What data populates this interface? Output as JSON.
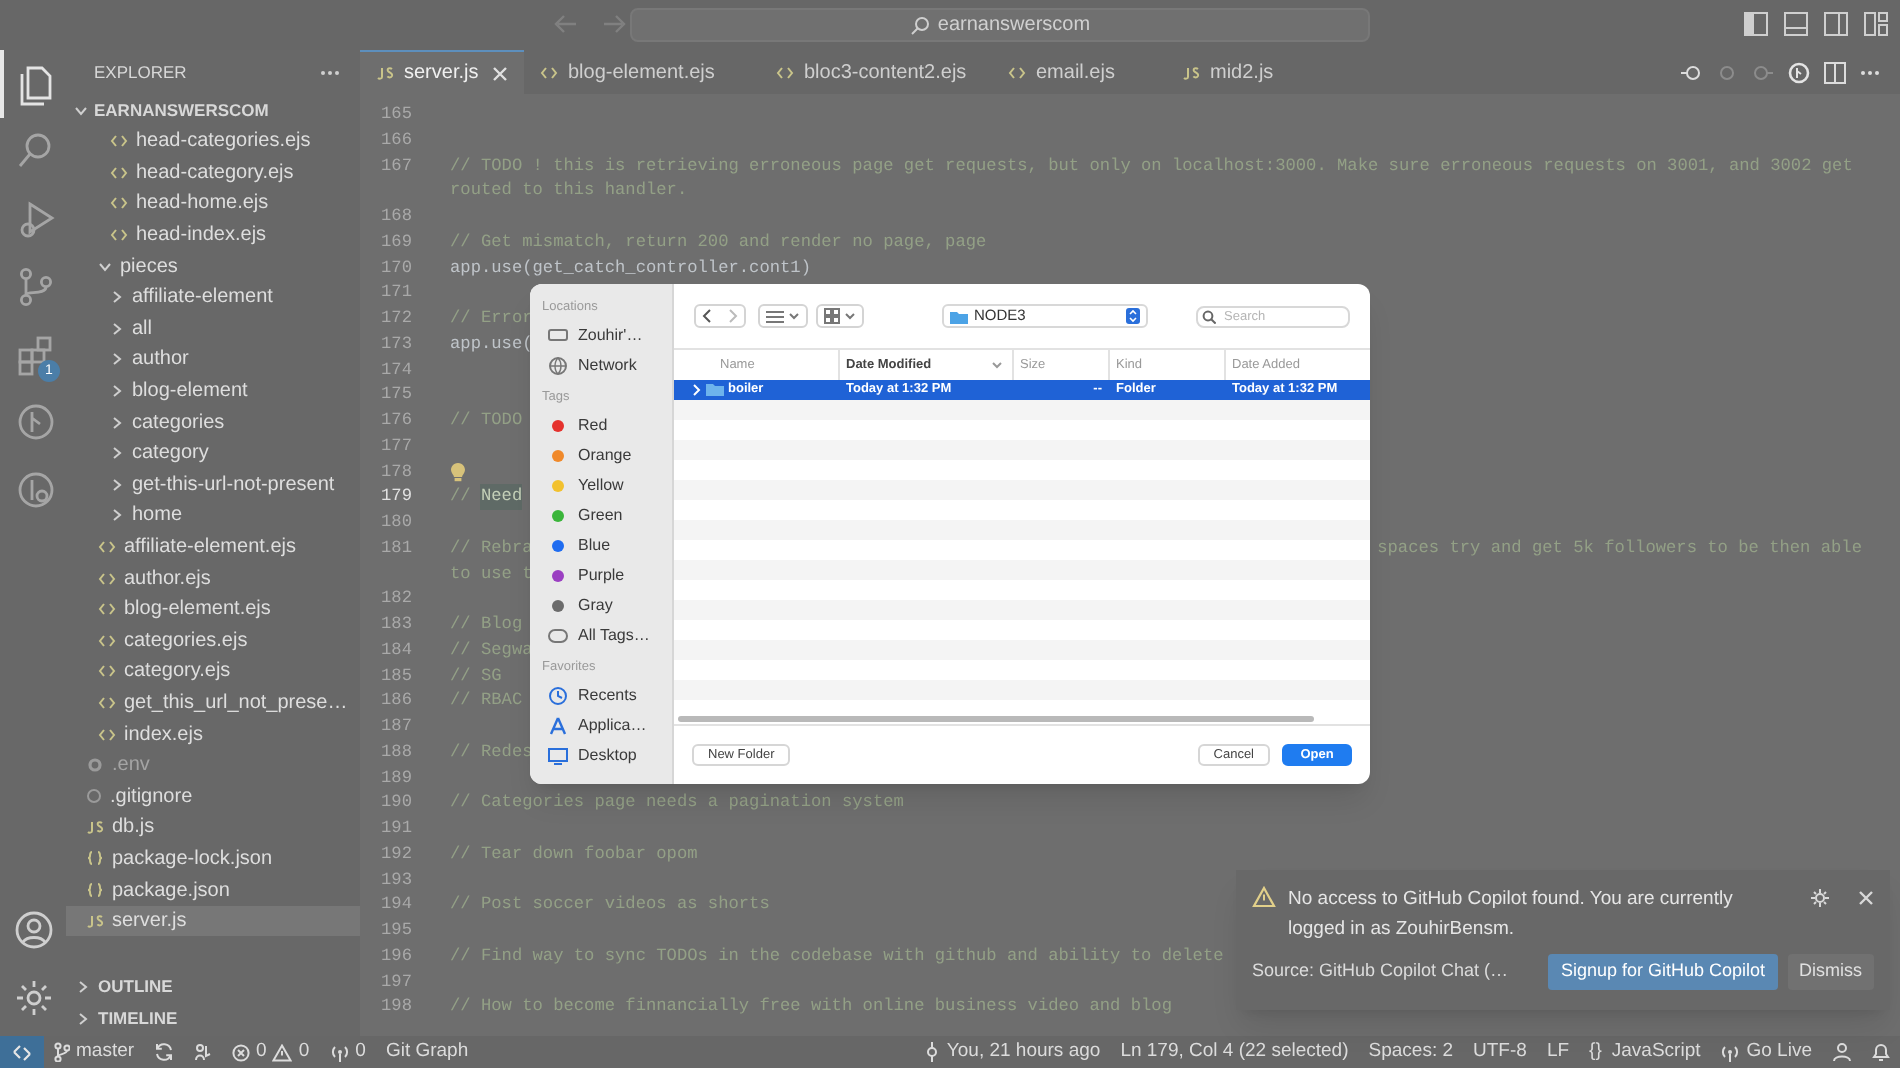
{
  "title_bar": {
    "search": "earnanswerscom"
  },
  "activity_bar": [
    {
      "kind": "explorer",
      "selected": true
    },
    {
      "kind": "search",
      "selected": false
    },
    {
      "kind": "run",
      "selected": false
    },
    {
      "kind": "source-control",
      "selected": false
    },
    {
      "kind": "extensions",
      "selected": false,
      "badge": "1"
    },
    {
      "kind": "git-graph",
      "selected": false
    },
    {
      "kind": "git-history",
      "selected": false
    }
  ],
  "activity_bar_bottom": [
    {
      "kind": "account"
    },
    {
      "kind": "settings"
    }
  ],
  "explorer": {
    "title": "EXPLORER",
    "root": {
      "label": "EARNANSWERSCOM",
      "expanded": true,
      "children": [
        {
          "children": [
            {
              "children": [
                {
                  "label": "head-categories.ejs",
                  "kind": "ejs",
                  "selected": false
                },
                {
                  "label": "head-category.ejs",
                  "kind": "ejs",
                  "selected": false
                },
                {
                  "label": "head-home.ejs",
                  "kind": "ejs",
                  "selected": false
                },
                {
                  "label": "head-index.ejs",
                  "kind": "ejs",
                  "selected": false
                }
              ]
            },
            {
              "label": "pieces",
              "kind": "folder",
              "expanded": true,
              "selected": false,
              "children": [
                {
                  "label": "affiliate-element",
                  "kind": "folder",
                  "expanded": false,
                  "selected": false
                },
                {
                  "label": "all",
                  "kind": "folder",
                  "expanded": false,
                  "selected": false
                },
                {
                  "label": "author",
                  "kind": "folder",
                  "expanded": false,
                  "selected": false
                },
                {
                  "label": "blog-element",
                  "kind": "folder",
                  "expanded": false,
                  "selected": false
                },
                {
                  "label": "categories",
                  "kind": "folder",
                  "expanded": false,
                  "selected": false
                },
                {
                  "label": "category",
                  "kind": "folder",
                  "expanded": false,
                  "selected": false
                },
                {
                  "label": "get-this-url-not-present",
                  "kind": "folder",
                  "expanded": false,
                  "selected": false
                },
                {
                  "label": "home",
                  "kind": "folder",
                  "expanded": false,
                  "selected": false
                }
              ]
            },
            {
              "label": "affiliate-element.ejs",
              "kind": "ejs",
              "selected": false
            },
            {
              "label": "author.ejs",
              "kind": "ejs",
              "selected": false
            },
            {
              "label": "blog-element.ejs",
              "kind": "ejs",
              "selected": false
            },
            {
              "label": "categories.ejs",
              "kind": "ejs",
              "selected": false
            },
            {
              "label": "category.ejs",
              "kind": "ejs",
              "selected": false
            },
            {
              "label": "get_this_url_not_prese…",
              "kind": "ejs",
              "selected": false
            },
            {
              "label": "index.ejs",
              "kind": "ejs",
              "selected": false
            }
          ]
        },
        {
          "label": ".env",
          "kind": "env",
          "selected": false
        },
        {
          "label": ".gitignore",
          "kind": "gitignore",
          "selected": false
        },
        {
          "label": "db.js",
          "kind": "js",
          "selected": false
        },
        {
          "label": "package-lock.json",
          "kind": "json",
          "selected": false
        },
        {
          "label": "package.json",
          "kind": "json",
          "selected": false
        },
        {
          "label": "server.js",
          "kind": "js",
          "selected": true
        }
      ]
    },
    "sections": [
      {
        "label": "OUTLINE",
        "expanded": false
      },
      {
        "label": "TIMELINE",
        "expanded": false
      }
    ]
  },
  "tabs": [
    {
      "label": "server.js",
      "kind": "js",
      "selected": true
    },
    {
      "label": "blog-element.ejs",
      "kind": "ejs",
      "selected": false
    },
    {
      "label": "bloc3-content2.ejs",
      "kind": "ejs",
      "selected": false
    },
    {
      "label": "email.ejs",
      "kind": "ejs",
      "selected": false
    },
    {
      "label": "mid2.js",
      "kind": "js",
      "selected": false
    }
  ],
  "code_lines": [
    {
      "number": "165",
      "kind": "blank",
      "current": false
    },
    {
      "number": "166",
      "kind": "blank",
      "current": false
    },
    {
      "number": "167",
      "kind": "comment",
      "text": "// TODO ! this is retrieving erroneous page get requests, but only on localhost:3000. Make sure erroneous requests on 3001, and 3002 get",
      "wrap": "routed to this handler.",
      "current": false
    },
    {
      "number": "168",
      "kind": "blank",
      "current": false
    },
    {
      "number": "169",
      "kind": "comment",
      "text": "// Get mismatch, return 200 and render no page, page",
      "current": false
    },
    {
      "number": "170",
      "kind": "code",
      "text": "app.use(get_catch_controller.cont1)",
      "current": false
    },
    {
      "number": "171",
      "kind": "blank",
      "current": false
    },
    {
      "number": "172",
      "kind": "comment",
      "text": "// Error",
      "current": false
    },
    {
      "number": "173",
      "kind": "code",
      "text": "app.use(",
      "current": false
    },
    {
      "number": "174",
      "kind": "blank",
      "current": false
    },
    {
      "number": "175",
      "kind": "blank",
      "current": false
    },
    {
      "number": "176",
      "kind": "comment",
      "text": "// TODO",
      "current": false
    },
    {
      "number": "177",
      "kind": "blank",
      "current": false
    },
    {
      "number": "178",
      "kind": "lightbulb",
      "current": false
    },
    {
      "number": "179",
      "kind": "comment",
      "text": "// ",
      "selection": "Need",
      "current": true
    },
    {
      "number": "180",
      "kind": "blank",
      "current": false
    },
    {
      "number": "181",
      "kind": "comment",
      "text": "// Rebra",
      "right": "spaces try and get 5k followers to be then able",
      "wrap": "to use t",
      "current": false
    },
    {
      "number": "182",
      "kind": "blank",
      "current": false
    },
    {
      "number": "183",
      "kind": "comment",
      "text": "// Blog",
      "current": false
    },
    {
      "number": "184",
      "kind": "comment",
      "text": "// Segwa",
      "current": false
    },
    {
      "number": "185",
      "kind": "comment",
      "text": "// SG",
      "current": false
    },
    {
      "number": "186",
      "kind": "comment",
      "text": "// RBAC",
      "current": false
    },
    {
      "number": "187",
      "kind": "blank",
      "current": false
    },
    {
      "number": "188",
      "kind": "comment",
      "text": "// Redes",
      "current": false
    },
    {
      "number": "189",
      "kind": "blank",
      "current": false
    },
    {
      "number": "190",
      "kind": "comment",
      "text": "// Categories page needs a pagination system",
      "current": false
    },
    {
      "number": "191",
      "kind": "blank",
      "current": false
    },
    {
      "number": "192",
      "kind": "comment",
      "text": "// Tear down foobar opom",
      "current": false
    },
    {
      "number": "193",
      "kind": "blank",
      "current": false
    },
    {
      "number": "194",
      "kind": "comment",
      "text": "// Post soccer videos as shorts",
      "current": false
    },
    {
      "number": "195",
      "kind": "blank",
      "current": false
    },
    {
      "number": "196",
      "kind": "comment",
      "text": "// Find way to sync TODOs in the codebase with github and ability to delete",
      "current": false
    },
    {
      "number": "197",
      "kind": "blank",
      "current": false
    },
    {
      "number": "198",
      "kind": "comment",
      "text": "// How to become finnancially free with online business video and blog",
      "current": false
    }
  ],
  "open_dialog": {
    "location": "NODE3",
    "search_placeholder": "Search",
    "sidebar": [
      {
        "heading": "Locations",
        "items": [
          {
            "label": "Zouhir'…",
            "kind": "disk"
          },
          {
            "label": "Network",
            "kind": "network"
          }
        ]
      },
      {
        "heading": "Tags",
        "items": [
          {
            "label": "Red",
            "kind": "tag",
            "color": "#e5322d"
          },
          {
            "label": "Orange",
            "kind": "tag",
            "color": "#f0892a"
          },
          {
            "label": "Yellow",
            "kind": "tag",
            "color": "#f2c12e"
          },
          {
            "label": "Green",
            "kind": "tag",
            "color": "#3ab53a"
          },
          {
            "label": "Blue",
            "kind": "tag",
            "color": "#1f6cf0"
          },
          {
            "label": "Purple",
            "kind": "tag",
            "color": "#9b3fc2"
          },
          {
            "label": "Gray",
            "kind": "tag",
            "color": "#6b6b6b"
          },
          {
            "label": "All Tags…",
            "kind": "all-tags"
          }
        ]
      },
      {
        "heading": "Favorites",
        "items": [
          {
            "label": "Recents",
            "kind": "recents"
          },
          {
            "label": "Applica…",
            "kind": "apps"
          },
          {
            "label": "Desktop",
            "kind": "desktop"
          }
        ]
      }
    ],
    "columns": [
      {
        "label": "Name",
        "sorted": false
      },
      {
        "label": "Date Modified",
        "sorted": true
      },
      {
        "label": "Size",
        "sorted": false
      },
      {
        "label": "Kind",
        "sorted": false
      },
      {
        "label": "Date Added",
        "sorted": false
      }
    ],
    "rows": [
      {
        "name": "boiler",
        "date_modified": "Today at 1:32 PM",
        "size": "--",
        "kind_text": "Folder",
        "date_added": "Today at 1:32 PM",
        "selected": true
      }
    ],
    "buttons": [
      {
        "label": "New Folder",
        "kind": "secondary"
      },
      {
        "label": "Cancel",
        "kind": "secondary"
      },
      {
        "label": "Open",
        "kind": "primary"
      }
    ]
  },
  "notification": {
    "message": "No access to GitHub Copilot found. You are currently logged in as ZouhirBensm.",
    "source": "Source: GitHub Copilot Chat (…",
    "buttons": [
      {
        "label": "Signup for GitHub Copilot",
        "kind": "primary"
      },
      {
        "label": "Dismiss",
        "kind": "secondary"
      }
    ]
  },
  "status_bar": {
    "left": [
      {
        "kind": "remote"
      },
      {
        "kind": "branch",
        "text": "master"
      },
      {
        "kind": "sync"
      },
      {
        "kind": "publish"
      },
      {
        "kind": "problems",
        "errors": "0",
        "warnings": "0"
      },
      {
        "kind": "ports",
        "text": "0"
      },
      {
        "kind": "text",
        "text": "Git Graph"
      }
    ],
    "right": [
      {
        "kind": "blame",
        "text": "You, 21 hours ago"
      },
      {
        "kind": "text",
        "text": "Ln 179, Col 4 (22 selected)"
      },
      {
        "kind": "text",
        "text": "Spaces: 2"
      },
      {
        "kind": "text",
        "text": "UTF-8"
      },
      {
        "kind": "text",
        "text": "LF"
      },
      {
        "kind": "language",
        "glyph": "{}",
        "text": "JavaScript"
      },
      {
        "kind": "live",
        "text": "Go Live"
      },
      {
        "kind": "feedback"
      },
      {
        "kind": "bell"
      }
    ]
  }
}
